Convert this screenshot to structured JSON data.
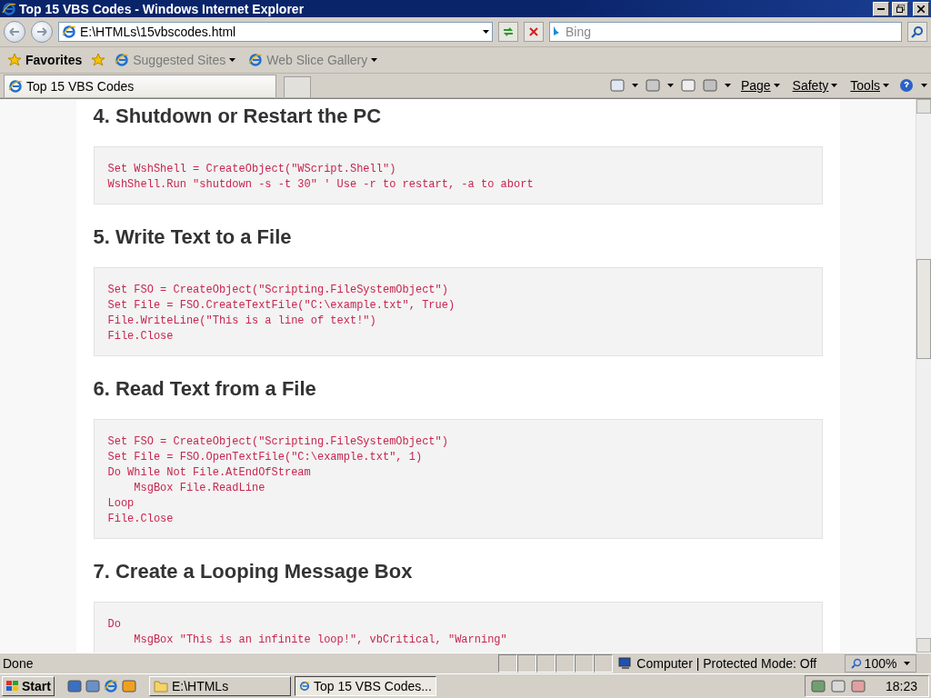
{
  "window": {
    "title": "Top 15 VBS Codes - Windows Internet Explorer"
  },
  "address_bar": {
    "url": "E:\\HTMLs\\15vbscodes.html"
  },
  "search": {
    "placeholder": "Bing"
  },
  "favorites_bar": {
    "favorites": "Favorites",
    "links": [
      "Suggested Sites",
      "Web Slice Gallery"
    ]
  },
  "tab": {
    "title": "Top 15 VBS Codes"
  },
  "command_bar": {
    "menus": [
      "Page",
      "Safety",
      "Tools"
    ]
  },
  "sections": [
    {
      "heading": "4. Shutdown or Restart the PC",
      "code": [
        "Set WshShell = CreateObject(\"WScript.Shell\")",
        "WshShell.Run \"shutdown -s -t 30\" ' Use -r to restart, -a to abort"
      ]
    },
    {
      "heading": "5. Write Text to a File",
      "code": [
        "Set FSO = CreateObject(\"Scripting.FileSystemObject\")",
        "Set File = FSO.CreateTextFile(\"C:\\example.txt\", True)",
        "File.WriteLine(\"This is a line of text!\")",
        "File.Close"
      ]
    },
    {
      "heading": "6. Read Text from a File",
      "code": [
        "Set FSO = CreateObject(\"Scripting.FileSystemObject\")",
        "Set File = FSO.OpenTextFile(\"C:\\example.txt\", 1)",
        "Do While Not File.AtEndOfStream",
        "    MsgBox File.ReadLine",
        "Loop",
        "File.Close"
      ]
    },
    {
      "heading": "7. Create a Looping Message Box",
      "code": [
        "Do",
        "    MsgBox \"This is an infinite loop!\", vbCritical, \"Warning\""
      ]
    }
  ],
  "status_bar": {
    "text": "Done",
    "zone": "Computer | Protected Mode: Off",
    "zoom": "100%"
  },
  "taskbar": {
    "start": "Start",
    "items": [
      {
        "label": "E:\\HTMLs",
        "selected": false
      },
      {
        "label": "Top 15 VBS Codes...",
        "selected": true
      }
    ],
    "clock": "18:23"
  }
}
